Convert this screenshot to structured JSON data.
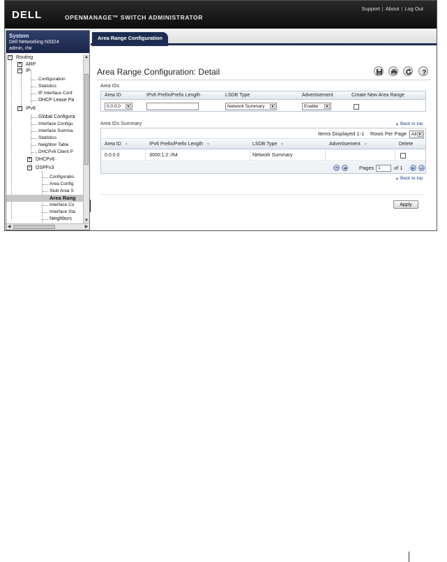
{
  "header": {
    "logo": "DELL",
    "app_title": "OPENMANAGE™ SWITCH ADMINISTRATOR",
    "links": [
      "Support",
      "About",
      "Log Out"
    ]
  },
  "system": {
    "title": "System",
    "model": "Dell Networking N3324",
    "user": "admin, r/w"
  },
  "nav": {
    "routing": "Routing",
    "arp": "ARP",
    "ip": "IP",
    "ip_items": [
      "Configuration",
      "Statistics",
      "IP Interface Conf",
      "DHCP Lease Pa"
    ],
    "ipv6": "IPv6",
    "ipv6_items": [
      "Global Configura",
      "Interface Configu",
      "Interface Summa",
      "Statistics",
      "Neighbor Table",
      "DHCPv6 Client P"
    ],
    "dhcpv6": "DHCPv6",
    "ospfv3": "OSPFv3",
    "ospfv3_items": [
      "Configuratio",
      "Area Config",
      "Stub Area S",
      "Area Rang",
      "Interface Co",
      "Interface Sta",
      "Neighbors"
    ]
  },
  "main": {
    "tab_label": "Area Range Configuration",
    "page_title": "Area Range Configuration: Detail",
    "toolbar_icons": [
      "save-icon",
      "print-icon",
      "refresh-icon",
      "help-icon"
    ]
  },
  "area_ids": {
    "section_label": "Area IDs",
    "columns": [
      "Area ID",
      "IPv6 Prefix/Prefix Length",
      "LSDB Type",
      "Advertisement",
      "Create New Area Range"
    ],
    "area_id_value": "0.0.0.0",
    "prefix_value": "",
    "lsdb_value": "Network Summary",
    "advertisement_value": "Enable",
    "create_new_checked": false
  },
  "summary": {
    "back_to_top": "Back to top",
    "section_label": "Area IDs Summary",
    "items_displayed": "Items Displayed 1-1",
    "rows_per_page_label": "Rows Per Page",
    "rows_per_page_value": "All",
    "columns": [
      "Area ID",
      "IPv6 Prefix/Prefix Length",
      "LSDB Type",
      "Advertisement",
      "Delete"
    ],
    "rows": [
      {
        "area_id": "0.0.0.0",
        "prefix": "3000:1:2::/64",
        "lsdb": "Network Summary",
        "advertisement": "",
        "delete": false
      }
    ],
    "pages_label": "Pages",
    "page_value": "1",
    "of_label": "of 1"
  },
  "back_to_top_2": "Back to top",
  "apply_label": "Apply",
  "colors": {
    "header_bg": "#111111",
    "tab_bg": "#1d2d52",
    "system_panel": "#1f2a4e",
    "link": "#1a3d8f"
  }
}
